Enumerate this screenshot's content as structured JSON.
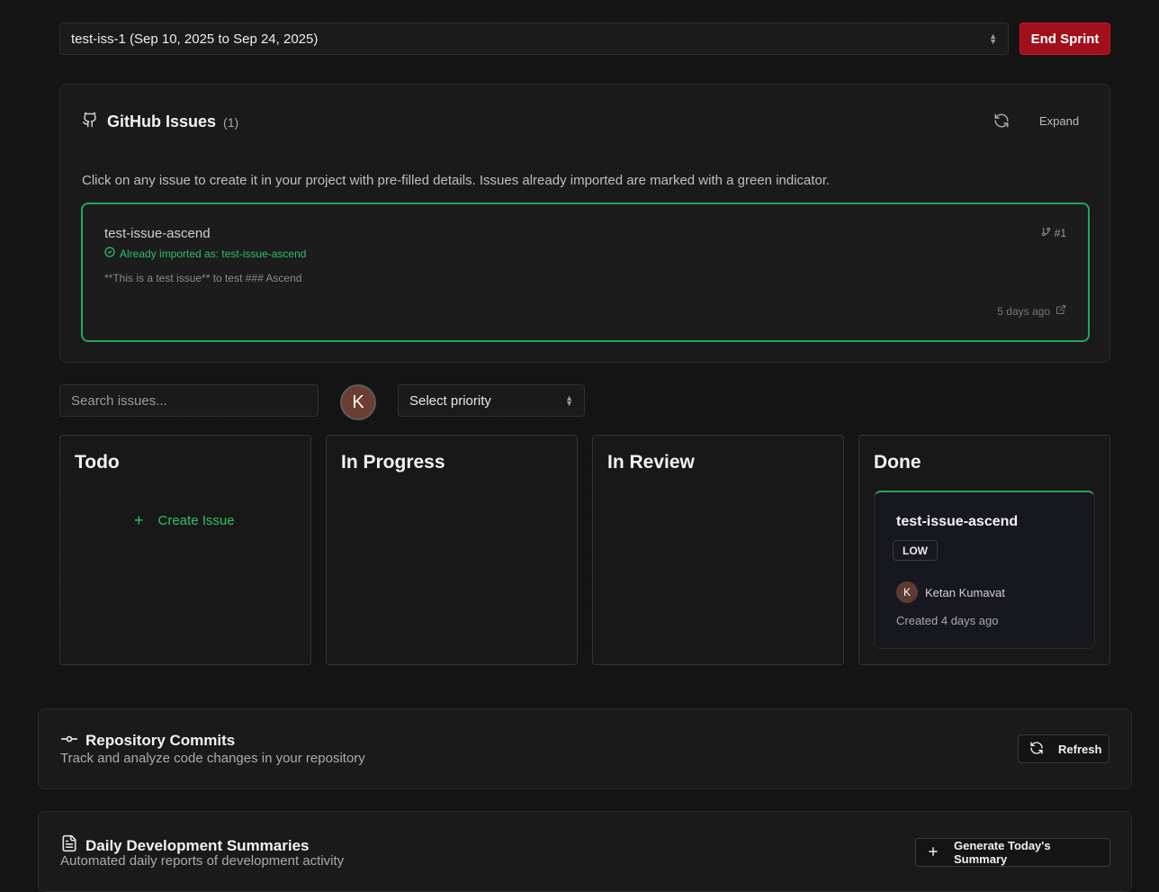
{
  "sprint": {
    "selected": "test-iss-1 (Sep 10, 2025 to Sep 24, 2025)",
    "end_label": "End Sprint"
  },
  "github": {
    "title": "GitHub Issues",
    "count": "(1)",
    "expand_label": "Expand",
    "description": "Click on any issue to create it in your project with pre-filled details. Issues already imported are marked with a green indicator.",
    "issue": {
      "title": "test-issue-ascend",
      "imported": "Already imported as: test-issue-ascend",
      "body": "**This is a test issue** to test ### Ascend",
      "number": "#1",
      "time": "5 days ago"
    }
  },
  "filters": {
    "search_placeholder": "Search issues...",
    "avatar_initial": "K",
    "priority_placeholder": "Select priority"
  },
  "board": {
    "columns": [
      {
        "title": "Todo"
      },
      {
        "title": "In Progress"
      },
      {
        "title": "In Review"
      },
      {
        "title": "Done"
      }
    ],
    "create_label": "Create Issue",
    "done_card": {
      "title": "test-issue-ascend",
      "priority": "LOW",
      "assignee_initial": "K",
      "assignee": "Ketan Kumavat",
      "created": "Created 4 days ago"
    }
  },
  "commits": {
    "title": "Repository Commits",
    "subtitle": "Track and analyze code changes in your repository",
    "refresh_label": "Refresh"
  },
  "summaries": {
    "title": "Daily Development Summaries",
    "subtitle": "Automated daily reports of development activity",
    "generate_label": "Generate Today's Summary"
  },
  "colors": {
    "accent_green": "#22a85a",
    "danger_red": "#a10f1c",
    "background": "#141414"
  }
}
